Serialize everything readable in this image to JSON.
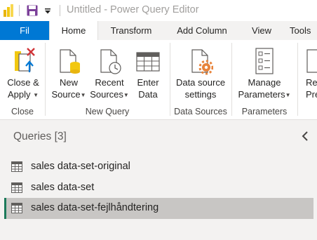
{
  "window": {
    "title": "Untitled - Power Query Editor",
    "logo_color": "#f2c811"
  },
  "tabs": [
    {
      "label": "Fil"
    },
    {
      "label": "Home"
    },
    {
      "label": "Transform"
    },
    {
      "label": "Add Column"
    },
    {
      "label": "View"
    },
    {
      "label": "Tools"
    }
  ],
  "ribbon": {
    "close": {
      "group_label": "Close",
      "close_apply": {
        "line1": "Close &",
        "line2": "Apply",
        "icon": "close-apply-icon"
      }
    },
    "new_query": {
      "group_label": "New Query",
      "new_source": {
        "line1": "New",
        "line2": "Source",
        "icon": "new-source-icon"
      },
      "recent_sources": {
        "line1": "Recent",
        "line2": "Sources",
        "icon": "recent-sources-icon"
      },
      "enter_data": {
        "line1": "Enter",
        "line2": "Data",
        "icon": "table-icon"
      }
    },
    "data_sources": {
      "group_label": "Data Sources",
      "settings": {
        "line1": "Data source",
        "line2": "settings",
        "icon": "gear-document-icon"
      }
    },
    "parameters": {
      "group_label": "Parameters",
      "manage": {
        "line1": "Manage",
        "line2": "Parameters",
        "icon": "parameters-icon"
      }
    },
    "partial": {
      "line1": "Re",
      "line2": "Pre"
    }
  },
  "queries": {
    "header": "Queries [3]",
    "items": [
      {
        "label": "sales data-set-original",
        "selected": false
      },
      {
        "label": "sales data-set",
        "selected": false
      },
      {
        "label": "sales data-set-fejlhåndtering",
        "selected": true
      }
    ]
  },
  "colors": {
    "file_tab": "#0078d4",
    "selection": "#c8c6c4",
    "selection_bar": "#1b7a5a",
    "pane_background": "#f3f2f1"
  }
}
